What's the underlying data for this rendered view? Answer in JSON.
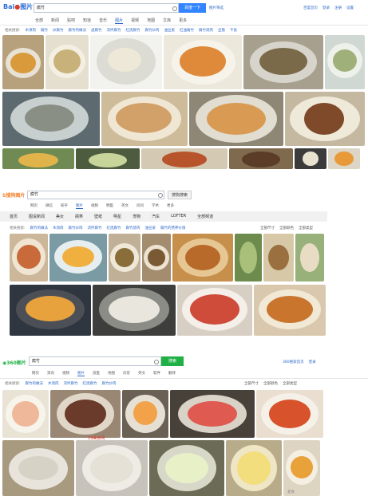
{
  "baidu": {
    "logo_left": "Bai",
    "logo_right": "图片",
    "query": "腐竹",
    "search_button": "百度一下",
    "search_sub": "图片筛选",
    "top_links": [
      "百度首页",
      "登录",
      "注册",
      "设置",
      "百度一下"
    ],
    "tabs": [
      "全部",
      "新闻",
      "贴吧",
      "知道",
      "音乐",
      "图片",
      "视频",
      "地图",
      "文库",
      "更多"
    ],
    "active_tab": "图片",
    "chips_label": "相关搜索:",
    "chips": [
      "木须肉",
      "腐竹",
      "炒腐竹",
      "腐竹的做法",
      "卤腐竹",
      "凉拌腐竹",
      "红烧腐竹",
      "腐竹炒肉",
      "油豆皮",
      "红油腐竹",
      "腐竹烧肉",
      "豆筋",
      "千张"
    ]
  },
  "sogou": {
    "logo": "搜狗图片",
    "query": "腐竹",
    "search_button": "搜狗搜索",
    "subtabs": [
      "网页",
      "微信",
      "知乎",
      "图片",
      "视频",
      "明医",
      "英文",
      "问问",
      "学术",
      "更多"
    ],
    "active_subtab": "图片",
    "categories": [
      "首页",
      "图说新闻",
      "美女",
      "搞笑",
      "壁纸",
      "明星",
      "宠物",
      "汽车",
      "LOFTER",
      "全部频道"
    ],
    "chips_label": "相关搜索:",
    "chips": [
      "腐竹的做法",
      "木须肉",
      "腐竹炒肉",
      "凉拌腐竹",
      "红烧腐竹",
      "腐竹烧肉",
      "油豆皮",
      "腐竹的营养价值"
    ],
    "filters": [
      "全部尺寸",
      "全部颜色",
      "全部类型"
    ]
  },
  "so360": {
    "logo": "360图片",
    "query": "腐竹",
    "search_button": "搜索",
    "top_links": [
      "360搜索首页",
      "登录"
    ],
    "tabs": [
      "网页",
      "资讯",
      "视频",
      "图片",
      "良医",
      "地图",
      "问答",
      "英文",
      "软件",
      "翻译"
    ],
    "active_tab": "图片",
    "chips_label": "相关搜索:",
    "chips": [
      "腐竹的做法",
      "木须肉",
      "凉拌腐竹",
      "红烧腐竹",
      "腐竹炒肉"
    ],
    "filters": [
      "全部尺寸",
      "全部颜色",
      "全部类型"
    ],
    "watermark_a": "19美食网",
    "watermark_b": "麦食"
  },
  "colors": {
    "baidu_blue": "#3385ff",
    "sogou_orange": "#f4802a",
    "so360_green": "#1fb145",
    "link_blue": "#2b67c8"
  }
}
